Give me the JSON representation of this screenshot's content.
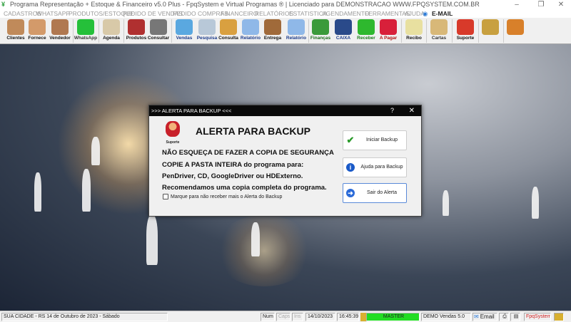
{
  "window": {
    "title": "Programa Representação + Estoque & Financeiro v5.0 Plus - FpqSystem e Virtual Programas ® | Licenciado para  DEMONSTRACAO WWW.FPQSYSTEM.COM.BR",
    "minimize": "–",
    "maximize": "❐",
    "close": "✕"
  },
  "menu": [
    "CADASTROS",
    "WHATSAPP",
    "PRODUTOS/ESTOQUE",
    "PEDIDO DE VENDAS",
    "PEDIDO COMPRAS",
    "FINANCEIRO",
    "RELATÓRIOS",
    "ESTATISTICA",
    "AGENDAMENTO",
    "FERRAMENTAS",
    "AJUDA",
    "E-MAIL"
  ],
  "toolbar": [
    {
      "label": "Clientes",
      "icon": "clients-icon",
      "color": "#c08a5a",
      "text": "#111"
    },
    {
      "label": "Fornece",
      "icon": "supplier-icon",
      "color": "#d39a6a",
      "text": "#111"
    },
    {
      "label": "Vendedor",
      "icon": "seller-icon",
      "color": "#b07850",
      "text": "#111"
    },
    {
      "label": "WhatsApp",
      "icon": "whatsapp-icon",
      "color": "#25c03a",
      "text": "#333"
    },
    {
      "label": "Agenda",
      "icon": "agenda-icon",
      "color": "#d8c9a8",
      "text": "#111"
    },
    {
      "label": "Produtos",
      "icon": "products-icon",
      "color": "#b03030",
      "text": "#111"
    },
    {
      "label": "Consultar",
      "icon": "barcode-icon",
      "color": "#777",
      "text": "#111"
    },
    {
      "label": "Vendas",
      "icon": "monitor-icon",
      "color": "#5aa8e0",
      "text": "#1a3a8a"
    },
    {
      "label": "Pesquisa",
      "icon": "search-doc-icon",
      "color": "#b8c8d8",
      "text": "#1a3a8a"
    },
    {
      "label": "Consulta",
      "icon": "drawer-icon",
      "color": "#d9a040",
      "text": "#111"
    },
    {
      "label": "Relatório",
      "icon": "printer-icon",
      "color": "#8fb8e8",
      "text": "#1a3a8a"
    },
    {
      "label": "Entrega",
      "icon": "hand-truck-icon",
      "color": "#a06a3a",
      "text": "#111"
    },
    {
      "label": "Relatório",
      "icon": "printer-icon",
      "color": "#8fb8e8",
      "text": "#1a3a8a"
    },
    {
      "label": "Finanças",
      "icon": "finance-icon",
      "color": "#3a9a3a",
      "text": "#1a6a1a"
    },
    {
      "label": "CAIXA",
      "icon": "cashbook-icon",
      "color": "#2a4a8a",
      "text": "#1a3a8a"
    },
    {
      "label": "Receber",
      "icon": "receive-dollar-icon",
      "color": "#2eb82e",
      "text": "#1a7a1a"
    },
    {
      "label": "A Pagar",
      "icon": "pay-dollar-icon",
      "color": "#d8203a",
      "text": "#b01010"
    },
    {
      "label": "Recibo",
      "icon": "receipt-icon",
      "color": "#e8e0a0",
      "text": "#111"
    },
    {
      "label": "Cartas",
      "icon": "scroll-icon",
      "color": "#d8b878",
      "text": "#333"
    },
    {
      "label": "Suporte",
      "icon": "support-icon",
      "color": "#d83a2a",
      "text": "#111"
    },
    {
      "label": "",
      "icon": "coin-icon",
      "color": "#c8a040",
      "text": "#111"
    },
    {
      "label": "",
      "icon": "exit-door-icon",
      "color": "#d8802a",
      "text": "#111"
    }
  ],
  "dialog": {
    "title": ">>> ALERTA PARA BACKUP <<<",
    "help": "?",
    "close": "✕",
    "logo_label": "Suporte",
    "heading": "ALERTA PARA BACKUP",
    "lines": [
      "NÃO ESQUEÇA DE FAZER A COPIA DE SEGURANÇA",
      "COPIE A PASTA INTEIRA do programa para:",
      "PenDriver, CD, GoogleDriver ou HDExterno.",
      "Recomendamos uma copia completa do programa."
    ],
    "checkbox": "Marque para não receber mais o Alerta do Backup",
    "buttons": {
      "start": "Iniciar Backup",
      "help": "Ajuda para Backup",
      "exit": "Sair do Alerta"
    }
  },
  "status": {
    "location": "SUA CIDADE - RS 14 de Outubro de 2023 - Sábado",
    "num": "Num",
    "caps": "Caps",
    "ins": "Ins",
    "date": "14/10/2023",
    "time": "16:45:39",
    "user": "MASTER",
    "version": "DEMO Vendas 5.0",
    "email": "Email",
    "brand": "FpqSystem",
    "user_color": "#22dd22",
    "brand_color": "#d02020"
  }
}
